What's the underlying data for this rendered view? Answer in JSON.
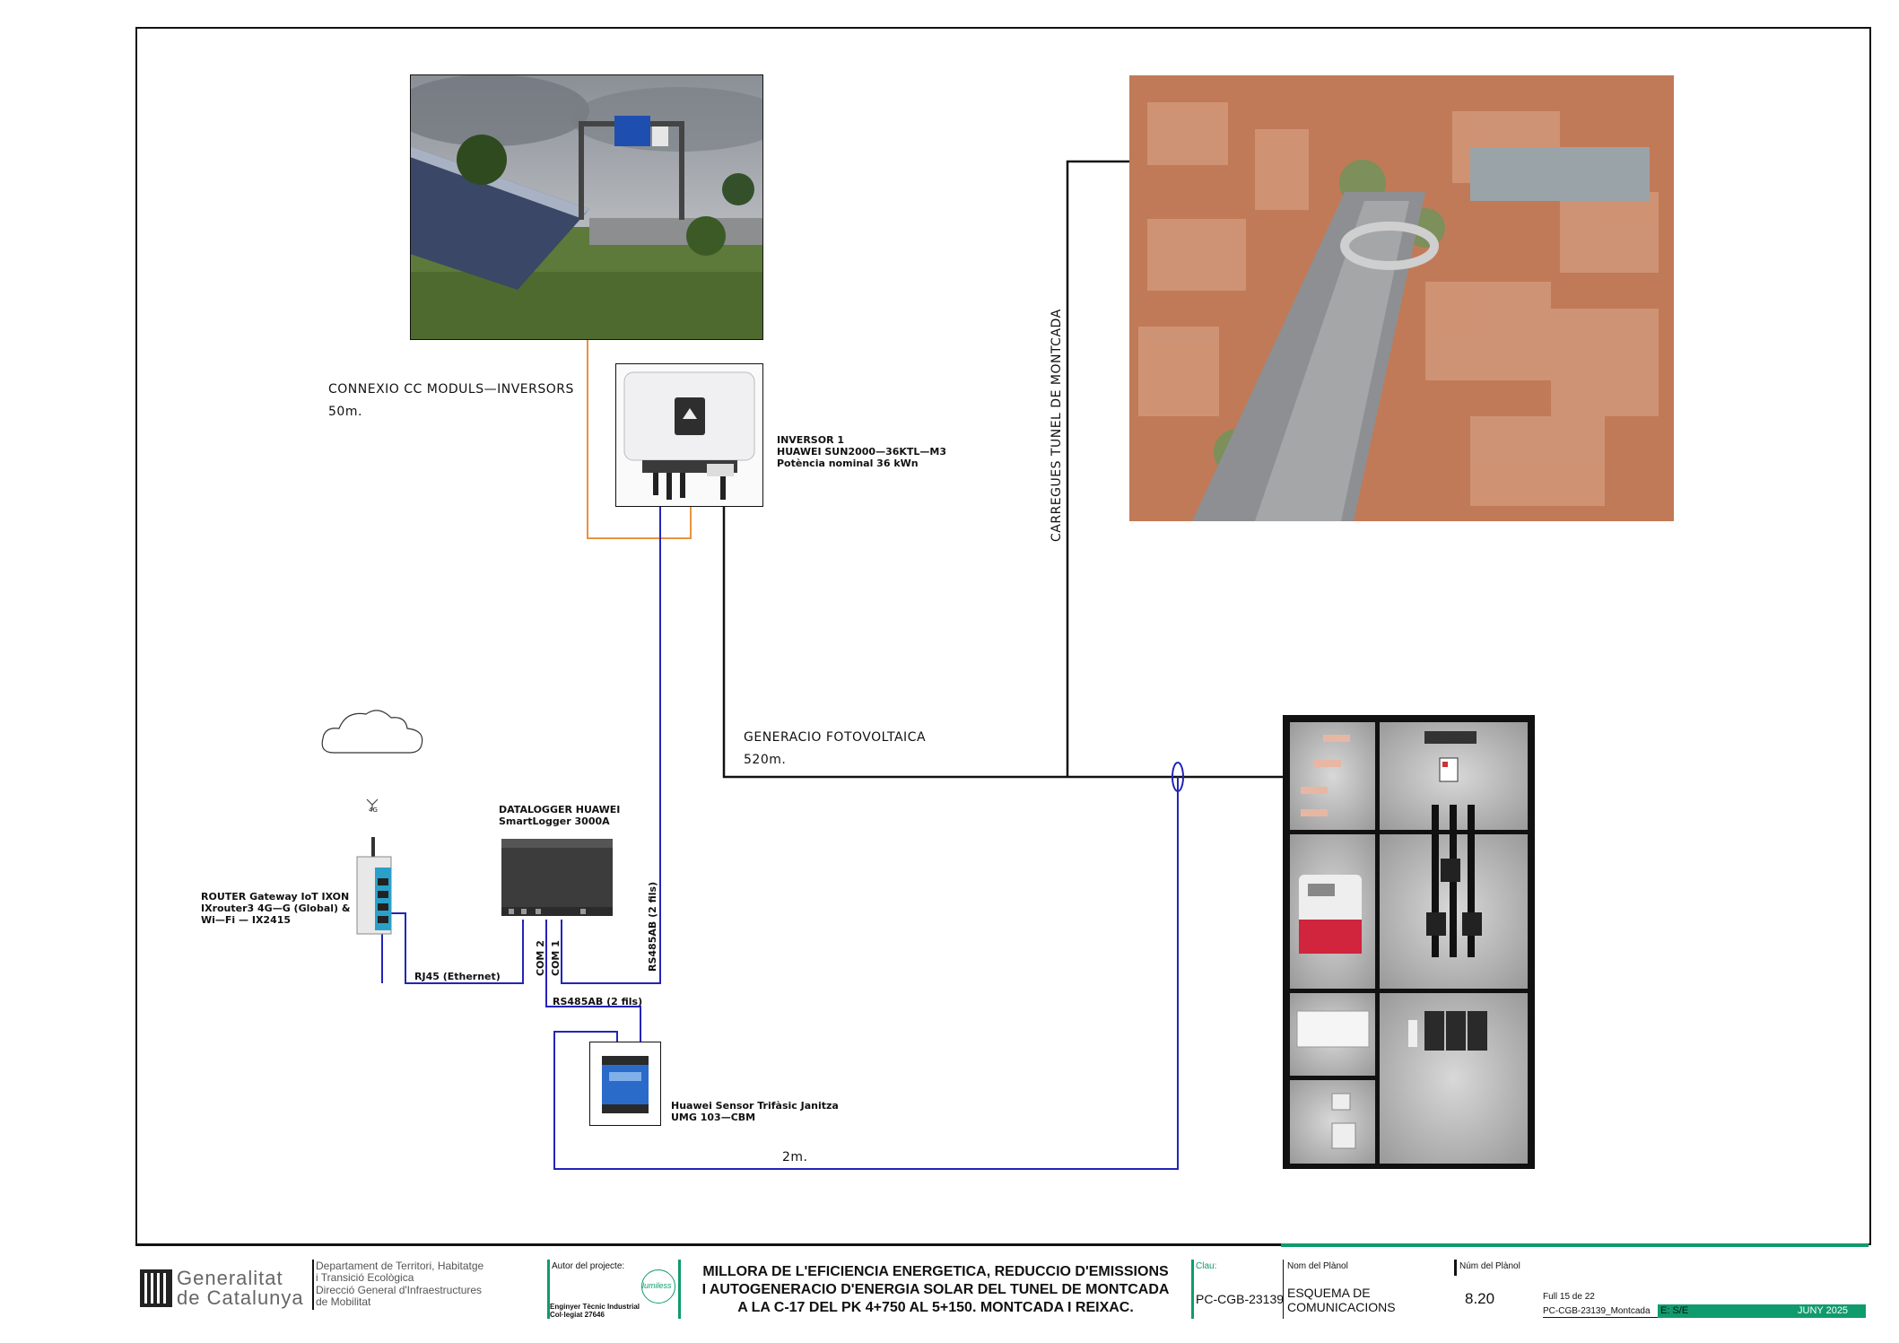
{
  "labels": {
    "cc_connection": "CONNEXIO CC MODULS—INVERSORS",
    "cc_distance": "50m.",
    "inverter_line1": "INVERSOR 1",
    "inverter_line2": "HUAWEI SUN2000—36KTL—M3",
    "inverter_line3": "Potència nominal 36 kWn",
    "pv_generation": "GENERACIO FOTOVOLTAICA",
    "pv_distance": "520m.",
    "tunnel_loads": "CARREGUES TUNEL DE MONTCADA",
    "datalogger_line1": "DATALOGGER HUAWEI",
    "datalogger_line2": "SmartLogger 3000A",
    "router_line1": "ROUTER Gateway IoT IXON",
    "router_line2": "IXrouter3 4G—G (Global) &",
    "router_line3": "Wi—Fi — IX2415",
    "rj45": "RJ45 (Ethernet)",
    "com2": "COM 2",
    "com1": "COM 1",
    "rs485_vertical": "RS485AB (2 fils)",
    "rs485_horizontal": "RS485AB (2 fils)",
    "sensor_line1": "Huawei Sensor Trifàsic Janitza",
    "sensor_line2": "UMG 103—CBM",
    "sensor_distance": "2m.",
    "antenna_text": "4G"
  },
  "title_block": {
    "org_line1": "Generalitat",
    "org_line2": "de Catalunya",
    "dept_line1": "Departament de Territori, Habitatge",
    "dept_line2": "i Transició Ecològica",
    "dept_line3": "Direcció General d'Infraestructures",
    "dept_line4": "de Mobilitat",
    "author_label": "Autor del projecte:",
    "author_line1": "Enginyer Tècnic Industrial",
    "author_line2": "Col·legiat 27646",
    "company_logo": "lumiless",
    "project_line1": "MILLORA DE L'EFICIENCIA ENERGETICA, REDUCCIO D'EMISSIONS",
    "project_line2": "I AUTOGENERACIO D'ENERGIA SOLAR DEL TUNEL DE MONTCADA",
    "project_line3": "A LA C-17 DEL PK 4+750 AL 5+150. MONTCADA I REIXAC.",
    "clau_label": "Clau:",
    "clau_value": "PC-CGB-23139",
    "plan_name_label": "Nom del Plànol",
    "plan_name_line1": "ESQUEMA DE",
    "plan_name_line2": "COMUNICACIONS",
    "plan_num_label": "Núm del Plànol",
    "plan_num_value": "8.20",
    "sheet": "Full 15 de 22",
    "file_name": "PC-CGB-23139_Montcada",
    "scale": "E: S/E",
    "date": "JUNY 2025"
  },
  "colors": {
    "orange_line": "#e8933f",
    "blue_line": "#2424b8",
    "black_line": "#111111",
    "accent_green": "#0f9b6e"
  }
}
